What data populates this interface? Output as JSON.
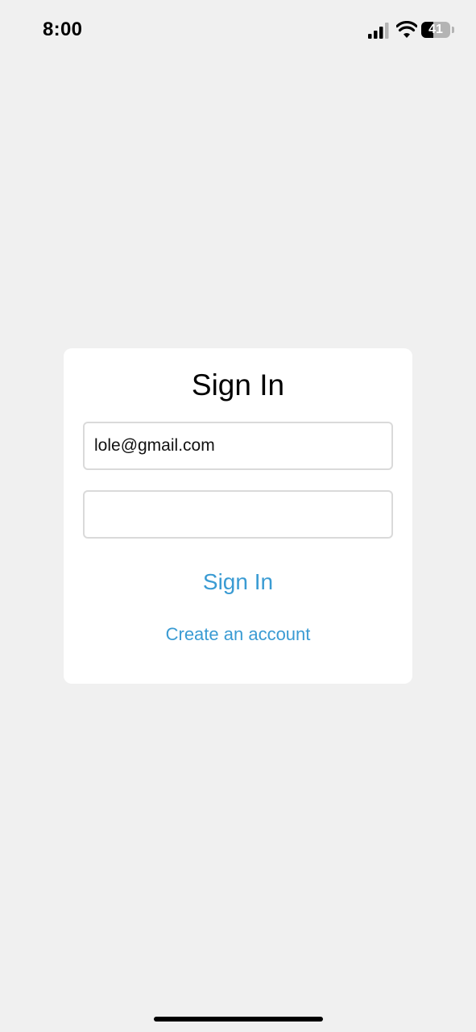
{
  "status_bar": {
    "time": "8:00",
    "battery_level": "41",
    "battery_fraction": 0.41,
    "signal_icon": "cellular-signal-icon",
    "wifi_icon": "wifi-icon",
    "battery_icon": "battery-icon"
  },
  "signin_form": {
    "title": "Sign In",
    "email_value": "lole@gmail.com",
    "password_value": "",
    "submit_label": "Sign In",
    "create_account_label": "Create an account"
  },
  "colors": {
    "background": "#f0f0f0",
    "card": "#ffffff",
    "accent": "#3a9bd3",
    "field_border": "#dadada"
  }
}
